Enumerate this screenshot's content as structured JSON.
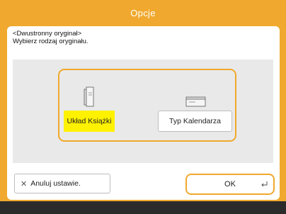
{
  "window": {
    "title": "Opcje"
  },
  "message": {
    "line1": "<Dwustronny oryginał>",
    "line2": "Wybierz rodzaj oryginału."
  },
  "options": [
    {
      "label": "Układ Książki",
      "icon": "book-layout-icon",
      "selected": true
    },
    {
      "label": "Typ Kalendarza",
      "icon": "calendar-layout-icon",
      "selected": false
    }
  ],
  "footer": {
    "cancel_label": "Anuluj ustawie.",
    "ok_label": "OK"
  },
  "colors": {
    "accent": "#f0a92e",
    "selected": "#fff200",
    "panel": "#e9e9e9",
    "bottom_bar": "#2b2b2b"
  }
}
